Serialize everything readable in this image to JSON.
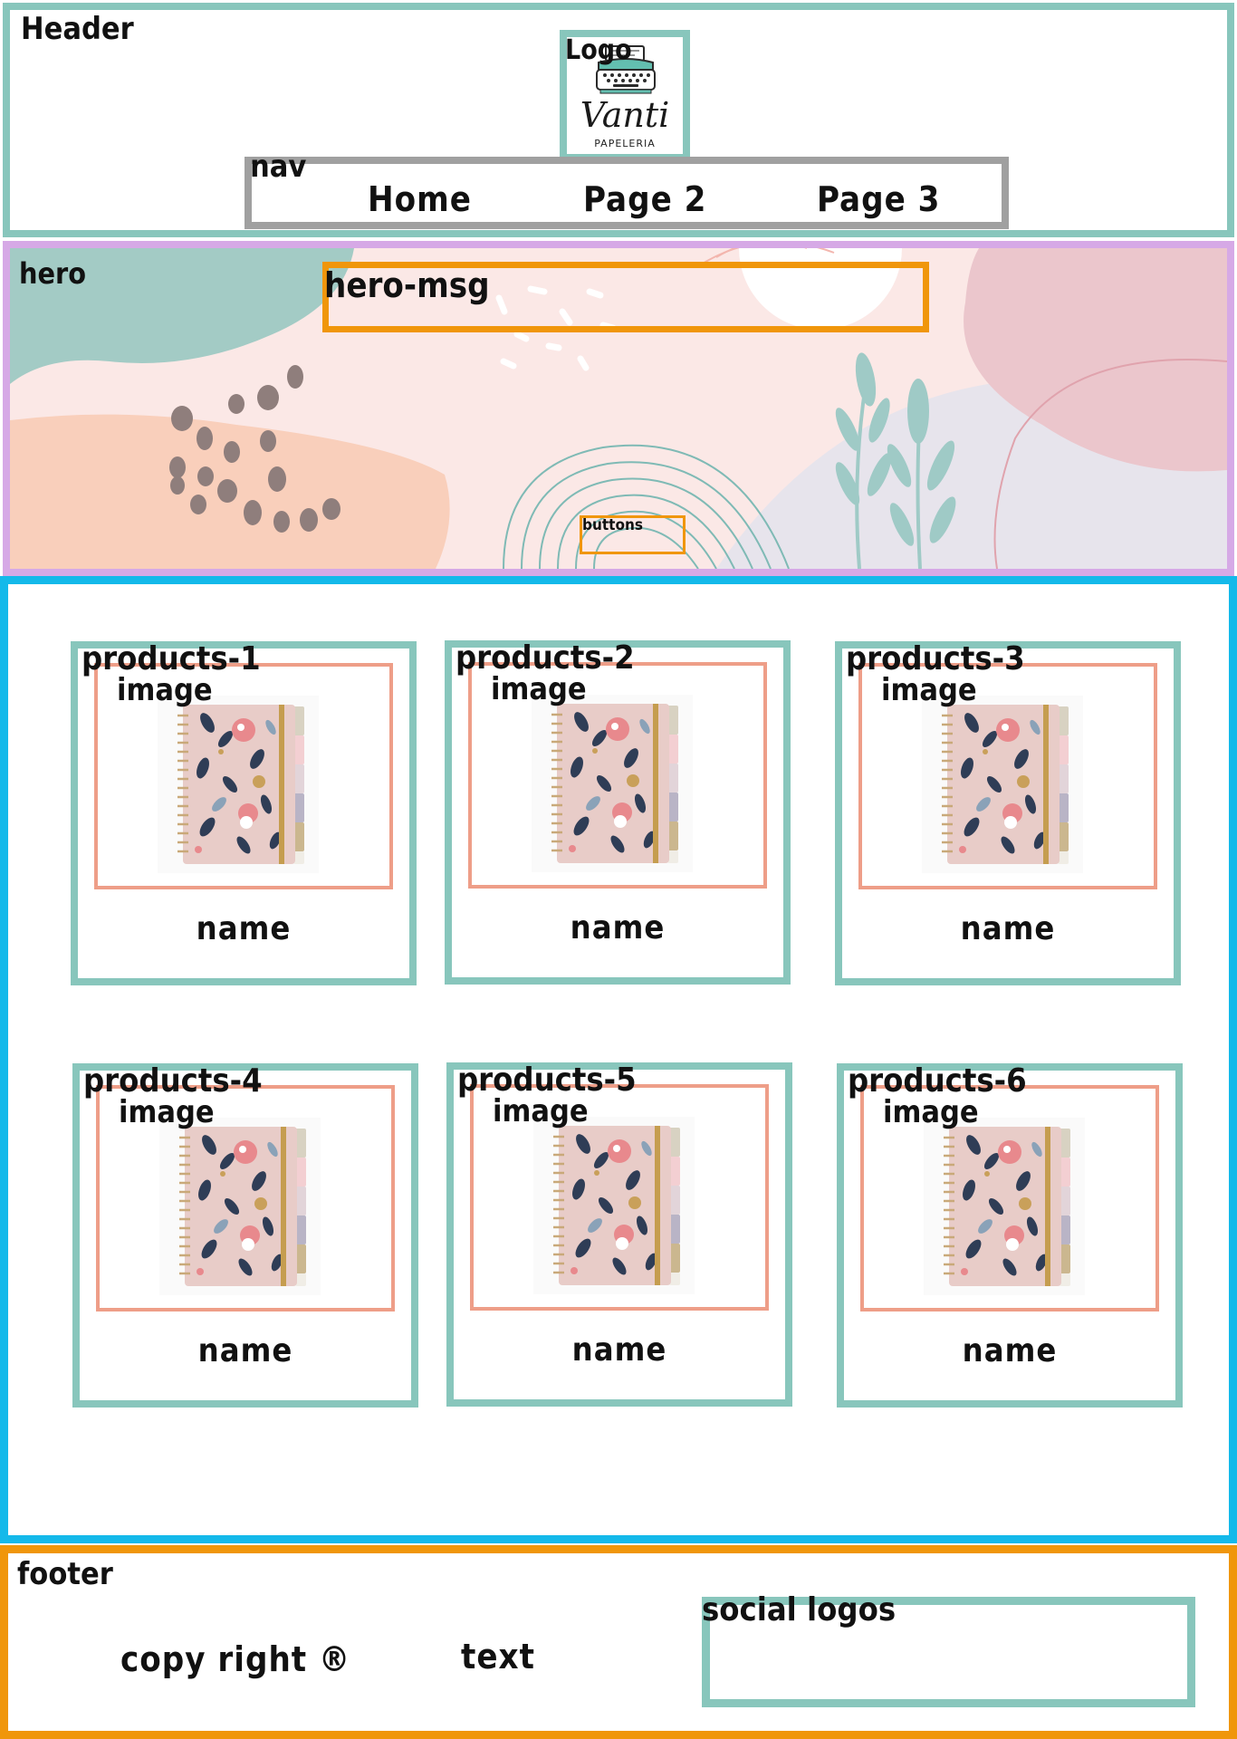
{
  "header": {
    "label": "Header",
    "logo": {
      "label": "Logo",
      "brand": "Vanti",
      "subtitle": "PAPELERIA"
    }
  },
  "nav": {
    "label": "nav",
    "links": [
      "Home",
      "Page 2",
      "Page 3"
    ]
  },
  "hero": {
    "label": "hero",
    "message_label": "hero-msg",
    "buttons_label": "buttons"
  },
  "products": [
    {
      "title": "products-1",
      "image_label": "image",
      "name": "name"
    },
    {
      "title": "products-2",
      "image_label": "image",
      "name": "name"
    },
    {
      "title": "products-3",
      "image_label": "image",
      "name": "name"
    },
    {
      "title": "products-4",
      "image_label": "image",
      "name": "name"
    },
    {
      "title": "products-5",
      "image_label": "image",
      "name": "name"
    },
    {
      "title": "products-6",
      "image_label": "image",
      "name": "name"
    }
  ],
  "footer": {
    "label": "footer",
    "copyright": "copy right ®",
    "text": "text",
    "social_label": "social logos"
  },
  "colors": {
    "header_border": "#88c6bc",
    "nav_border": "#a0a0a0",
    "hero_border": "#d6a9e6",
    "hero_msg_border": "#f0960b",
    "main_border": "#14b9ea",
    "card_border": "#88c6bc",
    "image_border": "#ee9e88",
    "footer_border": "#f0960b"
  }
}
